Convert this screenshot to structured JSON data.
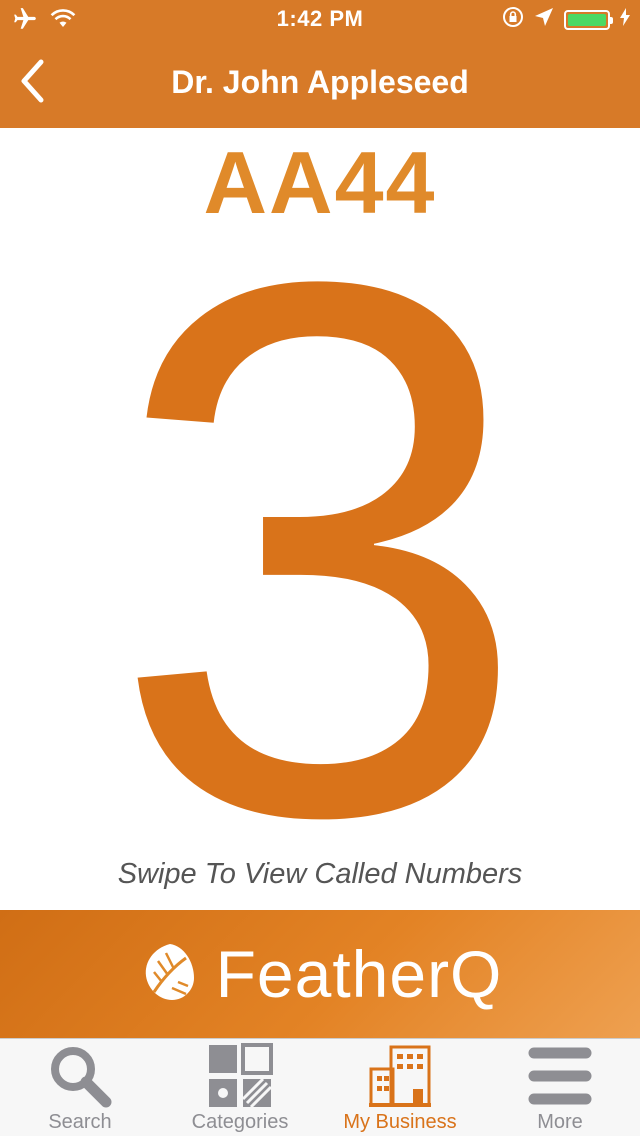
{
  "status_bar": {
    "time": "1:42 PM",
    "icons": [
      "airplane-icon",
      "wifi-icon",
      "rotation-lock-icon",
      "location-arrow-icon",
      "battery-icon",
      "charging-bolt-icon"
    ],
    "battery_color": "#4cd964"
  },
  "navbar": {
    "title": "Dr. John Appleseed",
    "back_icon": "chevron-left-icon"
  },
  "ticket": {
    "code": "AA44",
    "number": "3",
    "hint": "Swipe To View Called Numbers"
  },
  "brand": {
    "logo_icon": "feather-icon",
    "name": "FeatherQ"
  },
  "tabs": [
    {
      "label": "Search",
      "icon": "search-icon",
      "active": false
    },
    {
      "label": "Categories",
      "icon": "categories-icon",
      "active": false
    },
    {
      "label": "My Business",
      "icon": "building-icon",
      "active": true
    },
    {
      "label": "More",
      "icon": "menu-icon",
      "active": false
    }
  ],
  "colors": {
    "accent": "#d77a28",
    "code": "#e08a2a",
    "number": "#d9731a",
    "inactive_tab": "#8e8e93"
  }
}
